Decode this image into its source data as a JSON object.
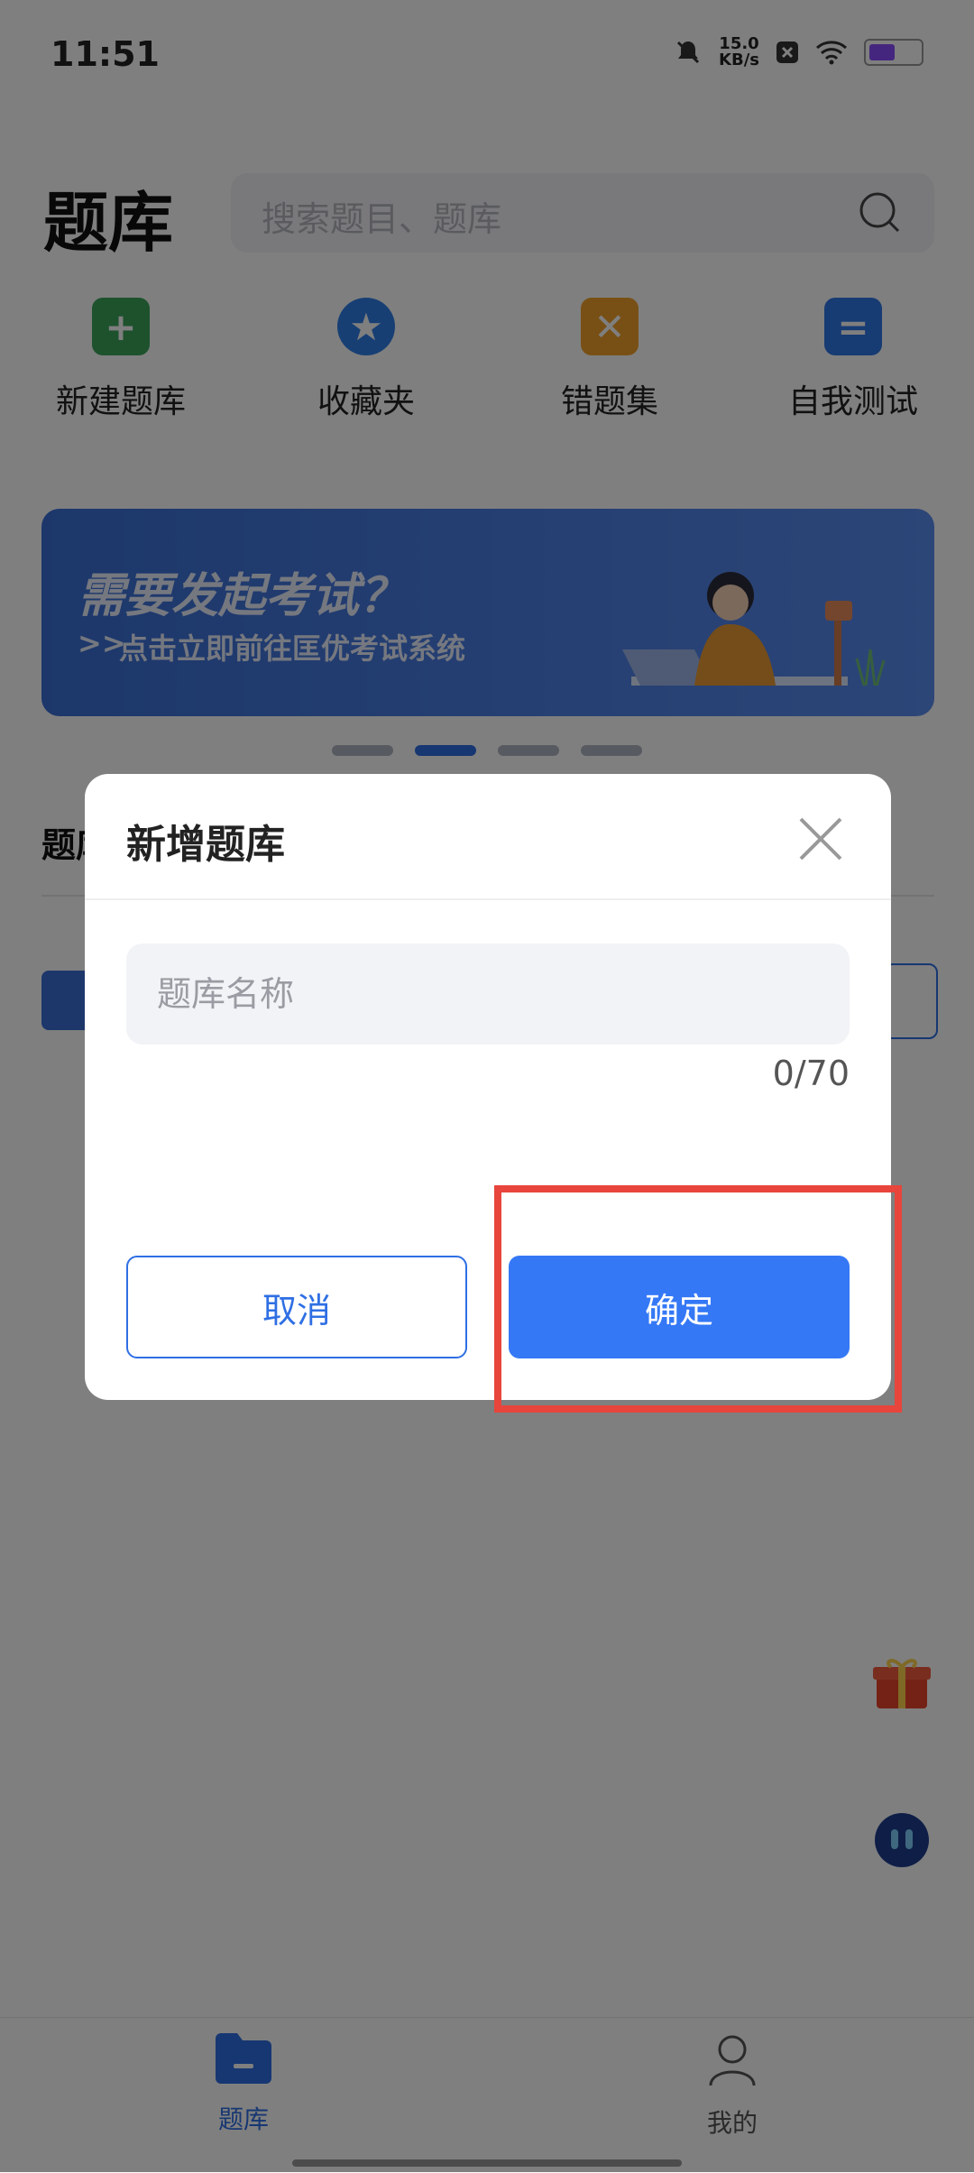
{
  "status_bar": {
    "time": "11:51",
    "speed_value": "15.0",
    "speed_unit": "KB/s"
  },
  "header": {
    "title": "题库",
    "search_placeholder": "搜索题目、题库"
  },
  "quick_entries": [
    {
      "label": "新建题库",
      "icon": "plus-folder-icon",
      "color": "#3aa55a"
    },
    {
      "label": "收藏夹",
      "icon": "star-badge-icon",
      "color": "#2e7fe8"
    },
    {
      "label": "错题集",
      "icon": "wrong-folder-icon",
      "color": "#f0a12a"
    },
    {
      "label": "自我测试",
      "icon": "test-doc-icon",
      "color": "#2f77e6"
    }
  ],
  "banner": {
    "title": "需要发起考试？",
    "arrows": ">>",
    "subtitle": "点击立即前往匡优考试系统"
  },
  "background_list": {
    "section_label": "题库"
  },
  "dialog": {
    "title": "新增题库",
    "input_placeholder": "题库名称",
    "input_value": "",
    "counter": "0/70",
    "cancel_label": "取消",
    "confirm_label": "确定"
  },
  "bottom_nav": [
    {
      "label": "题库",
      "icon": "folder-icon",
      "active": true
    },
    {
      "label": "我的",
      "icon": "person-icon",
      "active": false
    }
  ],
  "colors": {
    "accent": "#3478f6",
    "highlight": "#e8453c"
  }
}
